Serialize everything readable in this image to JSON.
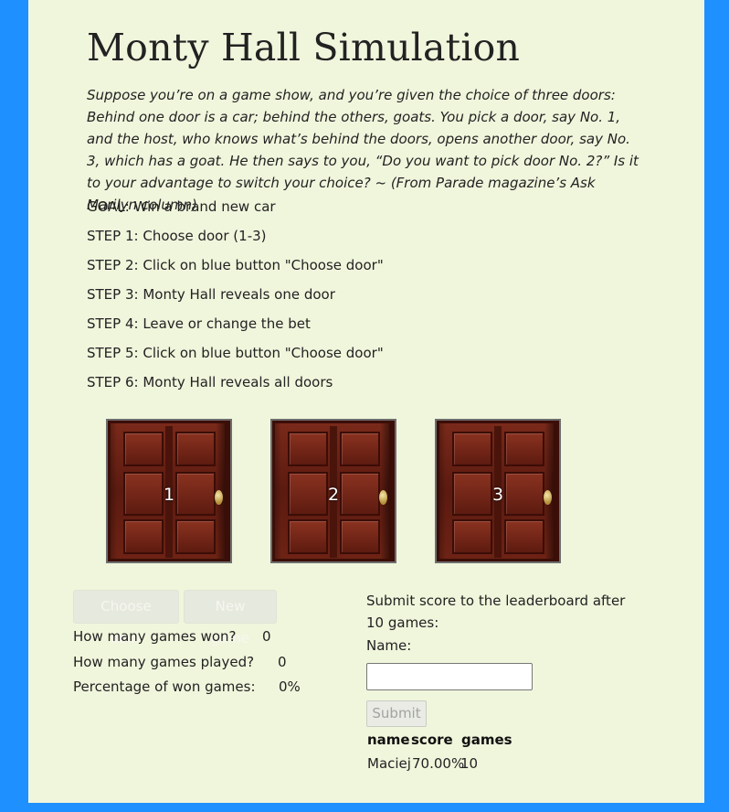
{
  "page": {
    "title": "Monty Hall Simulation",
    "intro": "Suppose you’re on a game show, and you’re given the choice of three doors: Behind one door is a car; behind the others, goats. You pick a door, say No. 1, and the host, who knows what’s behind the doors, opens another door, say No. 3, which has a goat. He then says to you, “Do you want to pick door No. 2?” Is it to your advantage to switch your choice? ~ (From Parade magazine’s Ask Marilyn column)",
    "steps": [
      "GOAL: Win a brand new car",
      "STEP 1: Choose door (1-3)",
      "STEP 2: Click on blue button \"Choose door\"",
      "STEP 3: Monty Hall reveals one door",
      "STEP 4: Leave or change the bet",
      "STEP 5: Click on blue button \"Choose door\"",
      "STEP 6: Monty Hall reveals all doors"
    ]
  },
  "doors": [
    {
      "label": "1"
    },
    {
      "label": "2"
    },
    {
      "label": "3"
    }
  ],
  "controls": {
    "choose_door": "Choose door",
    "new_game": "New game"
  },
  "stats": {
    "won_label": "How many games won?",
    "won_value": "0",
    "played_label": "How many games played?",
    "played_value": "0",
    "pct_label": "Percentage of won games:",
    "pct_value": "0%"
  },
  "leaderboard": {
    "prompt": "Submit score to the leaderboard after 10 games:",
    "name_label": "Name:",
    "name_value": "",
    "submit": "Submit",
    "headers": [
      "name",
      "score",
      "games"
    ],
    "rows": [
      {
        "name": "Maciej",
        "score": "70.00%",
        "games": "10"
      }
    ]
  },
  "colors": {
    "background": "#1e90ff",
    "panel": "#f0f6dc",
    "door": "#6a1f14"
  }
}
